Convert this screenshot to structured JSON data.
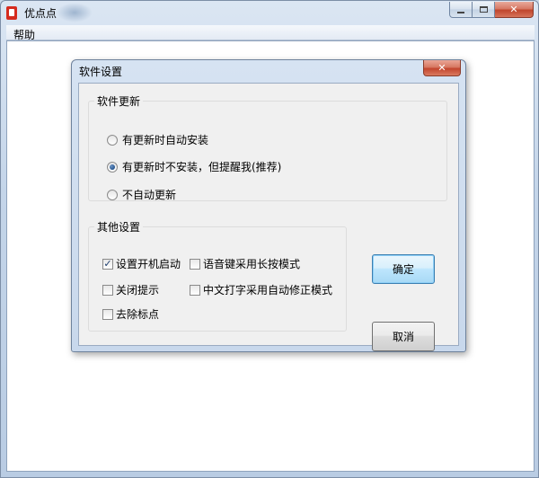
{
  "window": {
    "title": "优点点",
    "close_glyph": "✕"
  },
  "menu": {
    "items": [
      {
        "label": "帮助"
      }
    ]
  },
  "dialog": {
    "title": "软件设置",
    "close_glyph": "✕",
    "update_group": {
      "legend": "软件更新",
      "options": [
        {
          "label": "有更新时自动安装",
          "checked": false
        },
        {
          "label": "有更新时不安装，但提醒我(推荐)",
          "checked": true
        },
        {
          "label": "不自动更新",
          "checked": false
        }
      ]
    },
    "other_group": {
      "legend": "其他设置",
      "options": [
        {
          "label": "设置开机启动",
          "checked": true
        },
        {
          "label": "语音键采用长按模式",
          "checked": false
        },
        {
          "label": "关闭提示",
          "checked": false
        },
        {
          "label": "中文打字采用自动修正模式",
          "checked": false
        },
        {
          "label": "去除标点",
          "checked": false
        }
      ]
    },
    "ok_label": "确定",
    "cancel_label": "取消"
  }
}
